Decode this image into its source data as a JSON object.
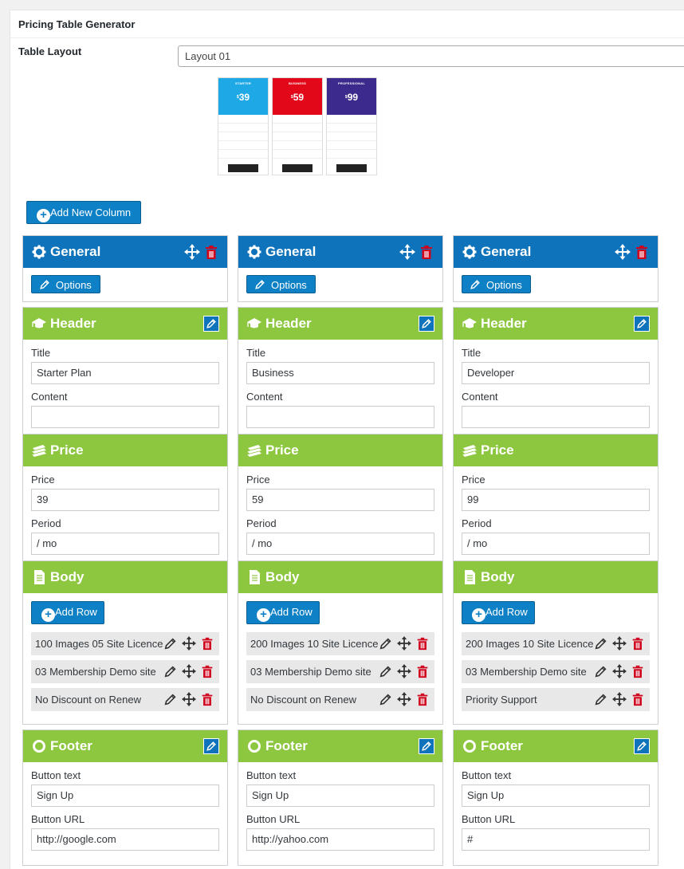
{
  "page": {
    "title": "Pricing Table Generator"
  },
  "layout": {
    "label": "Table Layout",
    "selected": "Layout 01"
  },
  "preview": {
    "columns": [
      {
        "name": "STARTER",
        "price": "39",
        "color": "#1ea8e6"
      },
      {
        "name": "BUSINESS",
        "price": "59",
        "color": "#e3071a"
      },
      {
        "name": "PROFESSIONAL",
        "price": "99",
        "color": "#3c2a8d"
      }
    ]
  },
  "add_column_label": "Add New Column",
  "sections": {
    "general": "General",
    "options": "Options",
    "header": "Header",
    "title_label": "Title",
    "content_label": "Content",
    "price": "Price",
    "price_label": "Price",
    "period_label": "Period",
    "body": "Body",
    "add_row": "Add Row",
    "footer": "Footer",
    "button_text_label": "Button text",
    "button_url_label": "Button URL"
  },
  "columns": [
    {
      "title": "Starter Plan",
      "content": "",
      "price": "39",
      "period": "/ mo",
      "rows": [
        "100 Images 05 Site Licence",
        "03 Membership Demo site",
        "No Discount on Renew"
      ],
      "button_text": "Sign Up",
      "button_url": "http://google.com"
    },
    {
      "title": "Business",
      "content": "",
      "price": "59",
      "period": "/ mo",
      "rows": [
        "200 Images 10 Site Licence",
        "03 Membership Demo site",
        "No Discount on Renew"
      ],
      "button_text": "Sign Up",
      "button_url": "http://yahoo.com"
    },
    {
      "title": "Developer",
      "content": "",
      "price": "99",
      "period": "/ mo",
      "rows": [
        "200 Images 10 Site Licence",
        "03 Membership Demo site",
        "Priority Support"
      ],
      "button_text": "Sign Up",
      "button_url": "#"
    }
  ],
  "colors": {
    "blue": "#0e73ba",
    "green": "#8dc63f",
    "delete": "#d0021b"
  },
  "icons": [
    "gear-icon",
    "move-icon",
    "trash-icon",
    "edit-icon",
    "pencil-icon",
    "mortarboard-icon",
    "money-icon",
    "document-icon",
    "circle-icon",
    "plus-icon"
  ]
}
